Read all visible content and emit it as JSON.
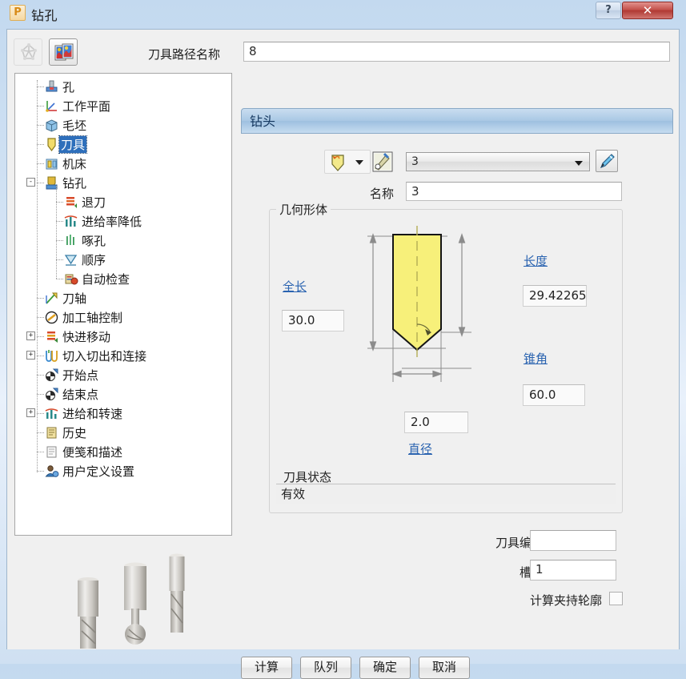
{
  "window": {
    "title": "钻孔",
    "app_badge": "P",
    "help_button": "?",
    "close_button": "✕"
  },
  "toolbar": {
    "recycle_icon": "recycle-icon",
    "tiles_icon": "tiles-icon",
    "toolpath_name_label": "刀具路径名称",
    "toolpath_name_value": "8"
  },
  "tree": {
    "items": [
      {
        "label": "孔",
        "indent": 1,
        "icon": "hole-icon",
        "selected": false,
        "expander": ""
      },
      {
        "label": "工作平面",
        "indent": 1,
        "icon": "workplane-icon",
        "selected": false,
        "expander": ""
      },
      {
        "label": "毛坯",
        "indent": 1,
        "icon": "block-icon",
        "selected": false,
        "expander": ""
      },
      {
        "label": "刀具",
        "indent": 1,
        "icon": "tool-icon",
        "selected": true,
        "expander": ""
      },
      {
        "label": "机床",
        "indent": 1,
        "icon": "machine-icon",
        "selected": false,
        "expander": ""
      },
      {
        "label": "钻孔",
        "indent": 1,
        "icon": "drilling-icon",
        "selected": false,
        "expander": "-"
      },
      {
        "label": "退刀",
        "indent": 2,
        "icon": "retract-icon",
        "selected": false,
        "expander": ""
      },
      {
        "label": "进给率降低",
        "indent": 2,
        "icon": "feedrate-icon",
        "selected": false,
        "expander": ""
      },
      {
        "label": "啄孔",
        "indent": 2,
        "icon": "peck-icon",
        "selected": false,
        "expander": ""
      },
      {
        "label": "顺序",
        "indent": 2,
        "icon": "order-icon",
        "selected": false,
        "expander": ""
      },
      {
        "label": "自动检查",
        "indent": 2,
        "icon": "autocheck-icon",
        "selected": false,
        "expander": ""
      },
      {
        "label": "刀轴",
        "indent": 1,
        "icon": "toolaxis-icon",
        "selected": false,
        "expander": ""
      },
      {
        "label": "加工轴控制",
        "indent": 1,
        "icon": "axiscontrol-icon",
        "selected": false,
        "expander": ""
      },
      {
        "label": "快进移动",
        "indent": 1,
        "icon": "rapidmove-icon",
        "selected": false,
        "expander": "+"
      },
      {
        "label": "切入切出和连接",
        "indent": 1,
        "icon": "leadlink-icon",
        "selected": false,
        "expander": "+"
      },
      {
        "label": "开始点",
        "indent": 1,
        "icon": "startpoint-icon",
        "selected": false,
        "expander": ""
      },
      {
        "label": "结束点",
        "indent": 1,
        "icon": "endpoint-icon",
        "selected": false,
        "expander": ""
      },
      {
        "label": "进给和转速",
        "indent": 1,
        "icon": "feedspeed-icon",
        "selected": false,
        "expander": "+"
      },
      {
        "label": "历史",
        "indent": 1,
        "icon": "history-icon",
        "selected": false,
        "expander": ""
      },
      {
        "label": "便笺和描述",
        "indent": 1,
        "icon": "notes-icon",
        "selected": false,
        "expander": ""
      },
      {
        "label": "用户定义设置",
        "indent": 1,
        "icon": "usersettings-icon",
        "selected": false,
        "expander": ""
      }
    ]
  },
  "panel": {
    "header_title": "钻头",
    "tool_type_icon": "drill-tip-icon",
    "tool_library_icon": "tool-library-icon",
    "tool_combo_value": "3",
    "pencil_icon": "pencil-edit-icon",
    "name_label": "名称",
    "name_value": "3"
  },
  "geometry": {
    "legend": "几何形体",
    "overall_length_label": "全长",
    "overall_length_value": "30.0",
    "length_label": "长度",
    "length_value": "29.42265",
    "taper_angle_label": "锥角",
    "taper_angle_value": "60.0",
    "diameter_label": "直径",
    "diameter_value": "2.0",
    "tool_status_label": "刀具状态",
    "tool_status_value": "有效",
    "drill_body_color": "#f7f07a",
    "drill_outline_color": "#151515",
    "dimension_line_color": "#8c8c8c"
  },
  "fields": {
    "tool_number_label": "刀具编号",
    "tool_number_value": "",
    "flutes_label": "槽数",
    "flutes_value": "1",
    "holder_profile_label": "计算夹持轮廓",
    "holder_profile_checked": false
  },
  "buttons": {
    "calculate": "计算",
    "queue": "队列",
    "ok": "确定",
    "cancel": "取消"
  },
  "colors": {
    "accent_link": "#2a63b0",
    "selection": "#2e6fbb",
    "panel_bg": "#f0f0f0",
    "titlebar_start": "#c3d9ef",
    "close_button": "#b03a34"
  }
}
